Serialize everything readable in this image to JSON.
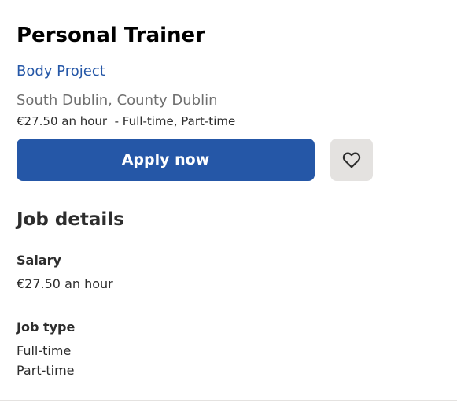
{
  "job": {
    "title": "Personal Trainer",
    "company": "Body Project",
    "location": "South Dublin, County Dublin",
    "pay_summary": "€27.50 an hour  - Full-time, Part-time"
  },
  "actions": {
    "apply_label": "Apply now",
    "save_icon": "heart-outline-icon"
  },
  "job_details": {
    "heading": "Job details",
    "salary": {
      "label": "Salary",
      "value": "€27.50 an hour"
    },
    "job_type": {
      "label": "Job type",
      "values": [
        "Full-time",
        "Part-time"
      ]
    }
  },
  "colors": {
    "accent": "#2557a7",
    "save_bg": "#e4e2e0",
    "muted_text": "#6f6f6f",
    "text": "#2d2d2d"
  }
}
